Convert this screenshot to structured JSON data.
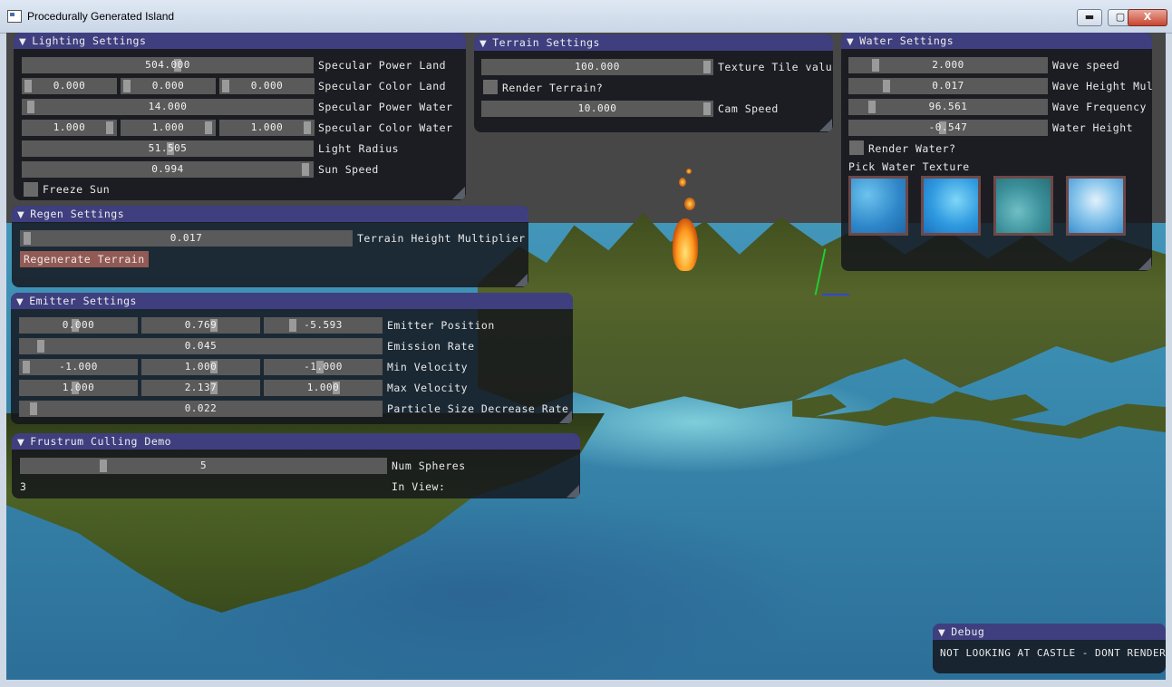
{
  "window": {
    "title": "Procedurally Generated Island",
    "min_label": "▬",
    "max_label": "▢",
    "close_label": "X"
  },
  "lighting": {
    "title": "Lighting Settings",
    "specular_power_land": {
      "value": "504.000",
      "label": "Specular Power Land"
    },
    "specular_color_land": {
      "values": [
        "0.000",
        "0.000",
        "0.000"
      ],
      "label": "Specular Color Land"
    },
    "specular_power_water": {
      "value": "14.000",
      "label": "Specular Power Water"
    },
    "specular_color_water": {
      "values": [
        "1.000",
        "1.000",
        "1.000"
      ],
      "label": "Specular Color Water"
    },
    "light_radius": {
      "value": "51.505",
      "label": "Light Radius"
    },
    "sun_speed": {
      "value": "0.994",
      "label": "Sun Speed"
    },
    "freeze_sun_label": "Freeze Sun"
  },
  "terrain": {
    "title": "Terrain Settings",
    "texture_tile": {
      "value": "100.000",
      "label": "Texture Tile value"
    },
    "render_terrain_label": "Render Terrain?",
    "cam_speed": {
      "value": "10.000",
      "label": "Cam Speed"
    }
  },
  "water": {
    "title": "Water Settings",
    "wave_speed": {
      "value": "2.000",
      "label": "Wave speed"
    },
    "wave_height": {
      "value": "0.017",
      "label": "Wave Height Mul"
    },
    "wave_frequency": {
      "value": "96.561",
      "label": "Wave Frequency"
    },
    "water_height": {
      "value": "-0.547",
      "label": "Water Height"
    },
    "render_water_label": "Render Water?",
    "pick_texture_label": "Pick Water Texture",
    "textures": [
      "water-texture-1",
      "water-texture-2",
      "water-texture-3",
      "water-texture-4"
    ]
  },
  "regen": {
    "title": "Regen Settings",
    "height_multiplier": {
      "value": "0.017",
      "label": "Terrain Height Multiplier"
    },
    "regenerate_label": "Regenerate Terrain"
  },
  "emitter": {
    "title": "Emitter Settings",
    "position": {
      "values": [
        "0.000",
        "0.769",
        "-5.593"
      ],
      "label": "Emitter Position"
    },
    "emission_rate": {
      "value": "0.045",
      "label": "Emission Rate"
    },
    "min_velocity": {
      "values": [
        "-1.000",
        "1.000",
        "-1.000"
      ],
      "label": "Min Velocity"
    },
    "max_velocity": {
      "values": [
        "1.000",
        "2.137",
        "1.000"
      ],
      "label": "Max Velocity"
    },
    "size_decrease": {
      "value": "0.022",
      "label": "Particle Size Decrease Rate"
    }
  },
  "frustum": {
    "title": "Frustrum Culling Demo",
    "num_spheres": {
      "value": "5",
      "label": "Num Spheres"
    },
    "in_view": {
      "value": "3",
      "label": "In View:"
    }
  },
  "debug": {
    "title": "Debug",
    "message": "NOT LOOKING AT CASTLE - DONT RENDER"
  },
  "colors": {
    "panel_header": "#3f3f80",
    "slider_bg": "#5a5a5a",
    "button_bg": "#915a55",
    "grab": "#9a9a9a"
  }
}
